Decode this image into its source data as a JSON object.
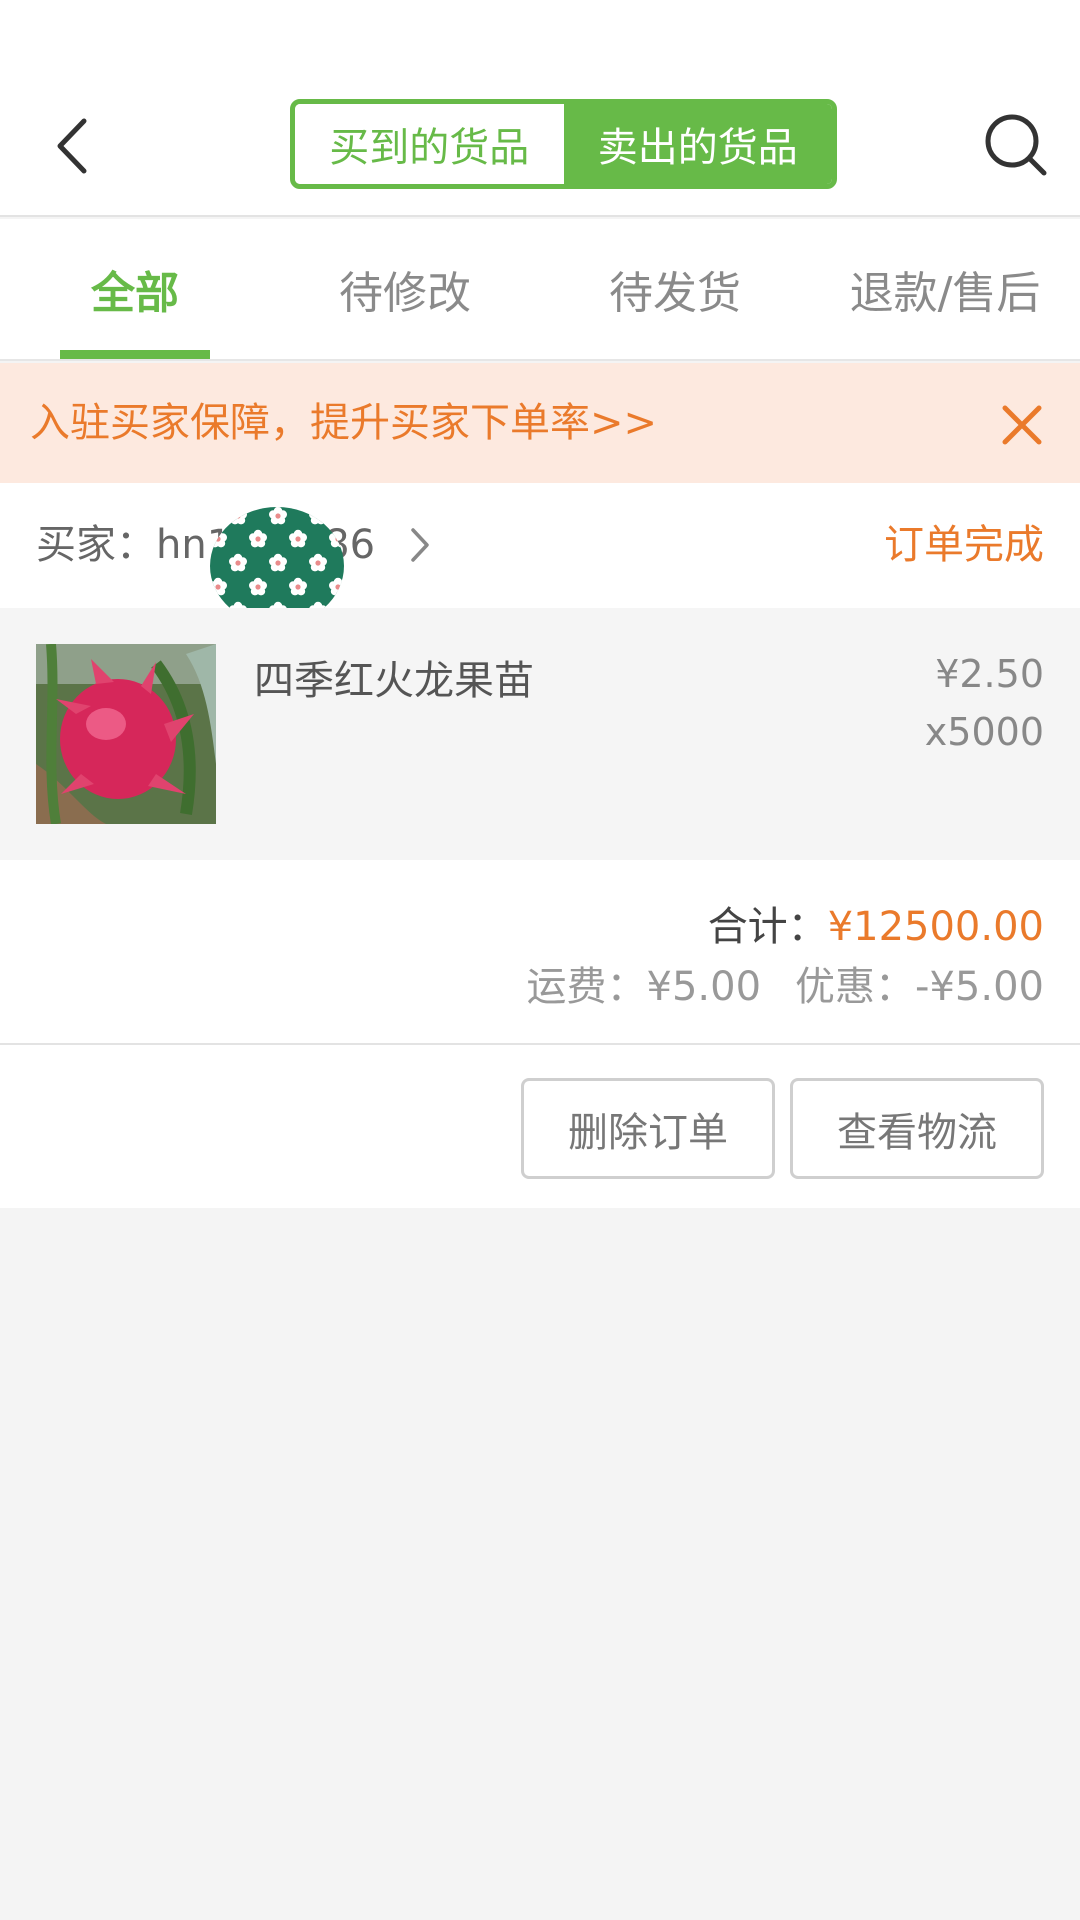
{
  "header": {
    "back_icon": "chevron-left-icon",
    "search_icon": "search-icon",
    "segments": [
      {
        "label": "买到的货品",
        "active": false
      },
      {
        "label": "卖出的货品",
        "active": true
      }
    ]
  },
  "tabs": [
    {
      "label": "全部",
      "selected": true
    },
    {
      "label": "待修改",
      "selected": false
    },
    {
      "label": "待发货",
      "selected": false
    },
    {
      "label": "退款/售后",
      "selected": false
    }
  ],
  "banner": {
    "text": "入驻买家保障，提升买家下单率>>",
    "close_icon": "close-icon"
  },
  "order": {
    "buyer_label": "买家：hn1",
    "buyer_label_tail": "86",
    "status": "订单完成",
    "product": {
      "name": "四季红火龙果苗",
      "price": "¥2.50",
      "quantity": "x5000"
    },
    "total_label": "合计：",
    "total_amount": "¥12500.00",
    "shipping": "运费：¥5.00",
    "discount": "优惠：-¥5.00",
    "buttons": {
      "delete": "删除订单",
      "logistics": "查看物流"
    }
  },
  "colors": {
    "accent_green": "#67ba48",
    "accent_orange": "#ea7a2b",
    "banner_bg": "#fde9df",
    "page_bg": "#f4f4f4"
  }
}
